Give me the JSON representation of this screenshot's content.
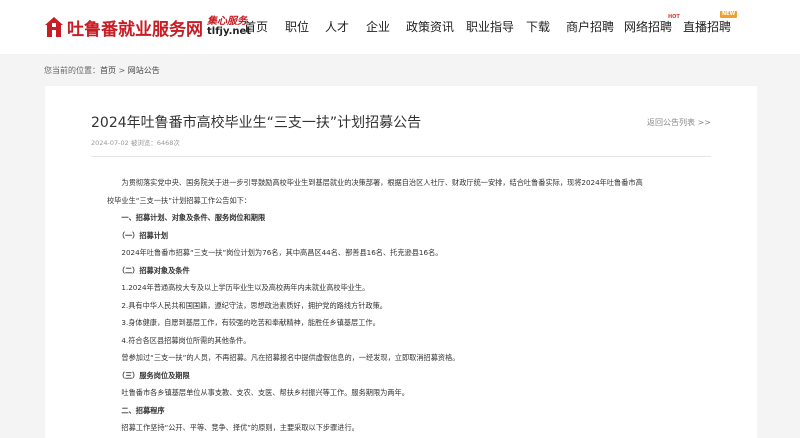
{
  "header": {
    "logo_text": "吐鲁番就业服务网",
    "logo_slogan": "集心服务",
    "logo_domain": "tlfjy.net",
    "nav": [
      {
        "label": "首页",
        "name": "nav-home"
      },
      {
        "label": "职位",
        "name": "nav-jobs"
      },
      {
        "label": "人才",
        "name": "nav-talent"
      },
      {
        "label": "企业",
        "name": "nav-companies"
      },
      {
        "label": "政策资讯",
        "name": "nav-policy-news"
      },
      {
        "label": "职业指导",
        "name": "nav-career-guidance"
      },
      {
        "label": "下载",
        "name": "nav-download"
      },
      {
        "label": "商户招聘",
        "name": "nav-merchant-recruitment"
      },
      {
        "label": "网络招聘",
        "name": "nav-online-recruitment"
      },
      {
        "label": "直播招聘",
        "name": "nav-live-recruitment"
      }
    ],
    "badge_hot": "HOT",
    "badge_new": "NEW"
  },
  "breadcrumb": {
    "prefix": "您当前的位置：",
    "home": "首页",
    "sep": " > ",
    "current": "网站公告"
  },
  "article": {
    "title": "2024年吐鲁番市高校毕业生“三支一扶”计划招募公告",
    "back_link": "返回公告列表 >>",
    "meta": "2024-07-02 被浏览：6468次",
    "paragraphs": [
      {
        "text": "　　为贯彻落实党中央、国务院关于进一步引导鼓励高校毕业生到基层就业的决策部署，根据自治区人社厅、财政厅统一安排，结合吐鲁番实际，现将2024年吐鲁番市高",
        "bold": false
      },
      {
        "text": "校毕业生“三支一扶”计划招募工作公告如下：",
        "bold": false
      },
      {
        "text": "　　一、招募计划、对象及条件、服务岗位和期限",
        "bold": true
      },
      {
        "text": "　　（一）招募计划",
        "bold": true
      },
      {
        "text": "　　2024年吐鲁番市招募“三支一扶”岗位计划为76名，其中高昌区44名、鄯善县16名、托克逊县16名。",
        "bold": false
      },
      {
        "text": "　　（二）招募对象及条件",
        "bold": true
      },
      {
        "text": "　　1.2024年普通高校大专及以上学历毕业生以及高校两年内未就业高校毕业生。",
        "bold": false
      },
      {
        "text": "　　2.具有中华人民共和国国籍，遵纪守法，思想政治素质好，拥护党的路线方针政策。",
        "bold": false
      },
      {
        "text": "　　3.身体健康，自愿到基层工作，有较强的吃苦和奉献精神，能胜任乡镇基层工作。",
        "bold": false
      },
      {
        "text": "　　4.符合各区县招募岗位所需的其他条件。",
        "bold": false
      },
      {
        "text": "　　曾参加过“三支一扶”的人员，不再招募。凡在招募报名中提供虚假信息的，一经发现，立即取消招募资格。",
        "bold": false
      },
      {
        "text": "　　（三）服务岗位及期限",
        "bold": true
      },
      {
        "text": "　　吐鲁番市各乡镇基层单位从事支教、支农、支医、帮扶乡村振兴等工作。服务期限为两年。",
        "bold": false
      },
      {
        "text": "　　二、招募程序",
        "bold": true
      },
      {
        "text": "　　招募工作坚持“公开、平等、竞争、择优”的原则，主要采取以下步骤进行。",
        "bold": false
      }
    ]
  }
}
